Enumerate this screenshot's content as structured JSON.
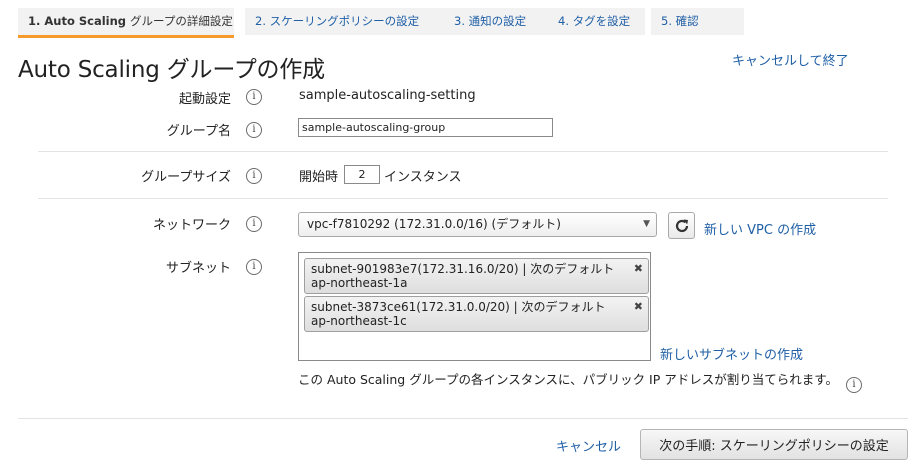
{
  "tabs": [
    {
      "label": "1. Auto Scaling",
      "sub": "グループの詳細設定",
      "active": true
    },
    {
      "label": "2. スケーリングポリシーの設定",
      "active": false
    },
    {
      "label": "3. 通知の設定",
      "active": false
    },
    {
      "label": "4. タグを設定",
      "active": false
    },
    {
      "label": "5. 確認",
      "active": false
    }
  ],
  "page": {
    "title": "Auto Scaling グループの作成",
    "cancel_exit": "キャンセルして終了"
  },
  "form": {
    "launch_config": {
      "label": "起動設定",
      "value": "sample-autoscaling-setting"
    },
    "group_name": {
      "label": "グループ名",
      "value": "sample-autoscaling-group"
    },
    "group_size": {
      "label": "グループサイズ",
      "prefix": "開始時",
      "value": "2",
      "suffix": "インスタンス"
    },
    "network": {
      "label": "ネットワーク",
      "selected": "vpc-f7810292 (172.31.0.0/16) (デフォルト)",
      "create_link": "新しい VPC の作成"
    },
    "subnet": {
      "label": "サブネット",
      "items": [
        {
          "text": "subnet-901983e7(172.31.16.0/20) | 次のデフォルト ap-northeast-1a"
        },
        {
          "text": "subnet-3873ce61(172.31.0.0/20) | 次のデフォルト ap-northeast-1c"
        }
      ],
      "create_link": "新しいサブネットの作成"
    },
    "public_ip_note": "この Auto Scaling グループの各インスタンスに、パブリック IP アドレスが割り当てられます。"
  },
  "footer": {
    "cancel": "キャンセル",
    "next": "次の手順: スケーリングポリシーの設定"
  },
  "colors": {
    "accent": "#f79a2e",
    "link": "#1f5fa6",
    "tab_bg": "#f2f2f2"
  }
}
